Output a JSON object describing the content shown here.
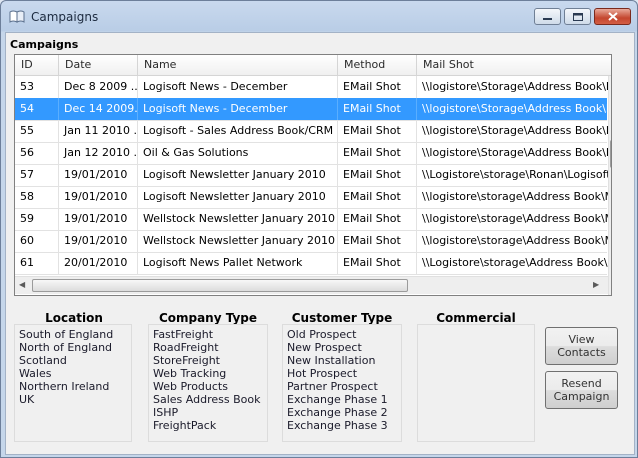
{
  "window": {
    "title": "Campaigns"
  },
  "campaigns": {
    "section_title": "Campaigns",
    "columns": [
      "ID",
      "Date",
      "Name",
      "Method",
      "Mail Shot"
    ],
    "rows": [
      [
        "53",
        "Dec  8 2009 ...",
        "Logisoft News - December",
        "EMail Shot",
        "\\\\logistore\\Storage\\Address Book\\Mail"
      ],
      [
        "54",
        "Dec 14 2009...",
        "Logisoft News - December",
        "EMail Shot",
        "\\\\logistore\\Storage\\Address Book\\Mail"
      ],
      [
        "55",
        "Jan 11 2010 ...",
        "Logisoft - Sales Address Book/CRM S...",
        "EMail Shot",
        "\\\\logistore\\Storage\\Address Book\\Mail"
      ],
      [
        "56",
        "Jan 12 2010 ...",
        "Oil & Gas Solutions",
        "EMail Shot",
        "\\\\logistore\\Storage\\Address Book\\Mail"
      ],
      [
        "57",
        "19/01/2010",
        "Logisoft Newsletter January 2010",
        "EMail Shot",
        "\\\\Logistore\\storage\\Ronan\\Logisoft Ne"
      ],
      [
        "58",
        "19/01/2010",
        "Logisoft Newsletter January 2010",
        "EMail Shot",
        "\\\\logistore\\storage\\Address Book\\Mail"
      ],
      [
        "59",
        "19/01/2010",
        "Wellstock Newsletter January 2010",
        "EMail Shot",
        "\\\\logistore\\storage\\Address Book\\Mail"
      ],
      [
        "60",
        "19/01/2010",
        "Wellstock Newsletter January 2010",
        "EMail Shot",
        "\\\\logistore\\storage\\Address Book\\Mail"
      ],
      [
        "61",
        "20/01/2010",
        "Logisoft News Pallet Network",
        "EMail Shot",
        "\\\\Logistore\\storage\\Address Book\\MailS"
      ]
    ],
    "selected_id": "54"
  },
  "filters": {
    "location": {
      "title": "Location",
      "items": [
        "South of England",
        "North of England",
        "Scotland",
        "Wales",
        "Northern Ireland",
        "UK"
      ]
    },
    "company_type": {
      "title": "Company Type",
      "items": [
        "FastFreight",
        "RoadFreight",
        "StoreFreight",
        "Web Tracking",
        "Web Products",
        "Sales Address Book",
        "ISHP",
        "FreightPack"
      ]
    },
    "customer_type": {
      "title": "Customer Type",
      "items": [
        "Old Prospect",
        "New Prospect",
        "New Installation",
        "Hot Prospect",
        "Partner Prospect",
        "Exchange Phase 1",
        "Exchange Phase 2",
        "Exchange Phase 3"
      ]
    },
    "commercial": {
      "title": "Commercial",
      "items": []
    }
  },
  "buttons": {
    "view_contacts": "View\nContacts",
    "resend_campaign": "Resend\nCampaign"
  },
  "colors": {
    "selection": "#3399ff",
    "title_bar": "#b9cde6",
    "close_button": "#c4462f"
  }
}
